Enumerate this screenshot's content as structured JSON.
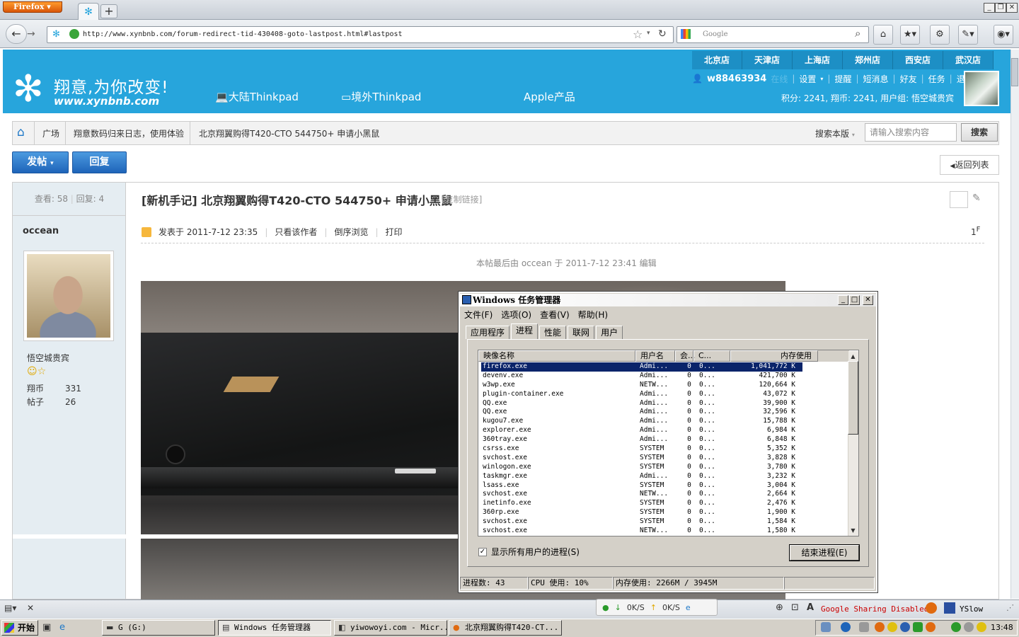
{
  "browser": {
    "menu_label": "Firefox",
    "url": "http://www.xynbnb.com/forum-redirect-tid-430408-goto-lastpost.html#lastpost",
    "search_placeholder": "Google",
    "new_tab": "+"
  },
  "site": {
    "logo_text": "翔意,为你改变!",
    "logo_domain": "www.xynbnb.com",
    "cities": [
      "北京店",
      "天津店",
      "上海店",
      "郑州店",
      "西安店",
      "武汉店"
    ],
    "nav": [
      "大陆Thinkpad",
      "境外Thinkpad",
      "Apple产品"
    ],
    "user": {
      "name": "w88463934",
      "online": "在线",
      "links": [
        "设置",
        "提醒",
        "短消息",
        "好友",
        "任务",
        "退出"
      ],
      "points": "积分: 2241",
      "coins": "翔币: 2241",
      "group": "用户组: 悟空城贵宾"
    }
  },
  "breadcrumb": {
    "items": [
      "广场",
      "翔意数码归来日志，使用体验",
      "北京翔翼购得T420-CTO 544750+ 申请小黑鼠"
    ],
    "search_scope": "搜索本版",
    "search_placeholder": "请输入搜索内容",
    "search_button": "搜索"
  },
  "actions": {
    "post": "发帖",
    "reply": "回复",
    "back": "返回列表"
  },
  "thread": {
    "stats_views_label": "查看:",
    "views": "58",
    "stats_replies_label": "回复:",
    "replies": "4",
    "title": "[新机手记] 北京翔翼购得T420-CTO 544750+ 申请小黑鼠",
    "copy_link": "[复制链接]",
    "author": "occean",
    "rank": "悟空城贵宾",
    "coins_label": "翔币",
    "coins": "331",
    "posts_label": "帖子",
    "posts": "26",
    "posted": "发表于 2011-7-12 23:35",
    "only_author": "只看该作者",
    "reverse": "倒序浏览",
    "print": "打印",
    "floor": "1",
    "floor_sup": "F",
    "edit_note": "本帖最后由 occean 于 2011-7-12 23:41 编辑"
  },
  "taskmgr": {
    "title": "Windows 任务管理器",
    "menu": [
      "文件(F)",
      "选项(O)",
      "查看(V)",
      "帮助(H)"
    ],
    "tabs": [
      "应用程序",
      "进程",
      "性能",
      "联网",
      "用户"
    ],
    "active_tab": "进程",
    "columns": [
      "映像名称",
      "用户名",
      "会...",
      "C...",
      "内存使用"
    ],
    "rows": [
      [
        "firefox.exe",
        "Admi...",
        "0",
        "0...",
        "1,041,772 K"
      ],
      [
        "devenv.exe",
        "Admi...",
        "0",
        "0...",
        "421,700 K"
      ],
      [
        "w3wp.exe",
        "NETW...",
        "0",
        "0...",
        "120,664 K"
      ],
      [
        "plugin-container.exe",
        "Admi...",
        "0",
        "0...",
        "43,072 K"
      ],
      [
        "QQ.exe",
        "Admi...",
        "0",
        "0...",
        "39,900 K"
      ],
      [
        "QQ.exe",
        "Admi...",
        "0",
        "0...",
        "32,596 K"
      ],
      [
        "kugou7.exe",
        "Admi...",
        "0",
        "0...",
        "15,788 K"
      ],
      [
        "explorer.exe",
        "Admi...",
        "0",
        "0...",
        "6,984 K"
      ],
      [
        "360tray.exe",
        "Admi...",
        "0",
        "0...",
        "6,848 K"
      ],
      [
        "csrss.exe",
        "SYSTEM",
        "0",
        "0...",
        "5,352 K"
      ],
      [
        "svchost.exe",
        "SYSTEM",
        "0",
        "0...",
        "3,828 K"
      ],
      [
        "winlogon.exe",
        "SYSTEM",
        "0",
        "0...",
        "3,780 K"
      ],
      [
        "taskmgr.exe",
        "Admi...",
        "0",
        "0...",
        "3,232 K"
      ],
      [
        "lsass.exe",
        "SYSTEM",
        "0",
        "0...",
        "3,004 K"
      ],
      [
        "svchost.exe",
        "NETW...",
        "0",
        "0...",
        "2,664 K"
      ],
      [
        "inetinfo.exe",
        "SYSTEM",
        "0",
        "0...",
        "2,476 K"
      ],
      [
        "360rp.exe",
        "SYSTEM",
        "0",
        "0...",
        "1,900 K"
      ],
      [
        "svchost.exe",
        "SYSTEM",
        "0",
        "0...",
        "1,584 K"
      ],
      [
        "svchost.exe",
        "NETW...",
        "0",
        "0...",
        "1,580 K"
      ]
    ],
    "show_all": "显示所有用户的进程(S)",
    "end_process": "结束进程(E)",
    "status_procs": "进程数: 43",
    "status_cpu": "CPU 使用: 10%",
    "status_mem": "内存使用: 2266M / 3945M"
  },
  "addonbar": {
    "down": "0K/S",
    "up": "0K/S",
    "google_sharing": "Google Sharing Disabled",
    "yslow": "YSlow"
  },
  "taskbar": {
    "start": "开始",
    "tasks": [
      "G (G:)",
      "Windows 任务管理器",
      "yiwowoyi.com - Micr...",
      "北京翔翼购得T420-CT..."
    ],
    "clock": "13:48"
  },
  "colors": {
    "header": "#27a5dc",
    "city_bg": "#1d8fc5",
    "button_blue": "#1e64b9",
    "selection": "#0a246a"
  }
}
